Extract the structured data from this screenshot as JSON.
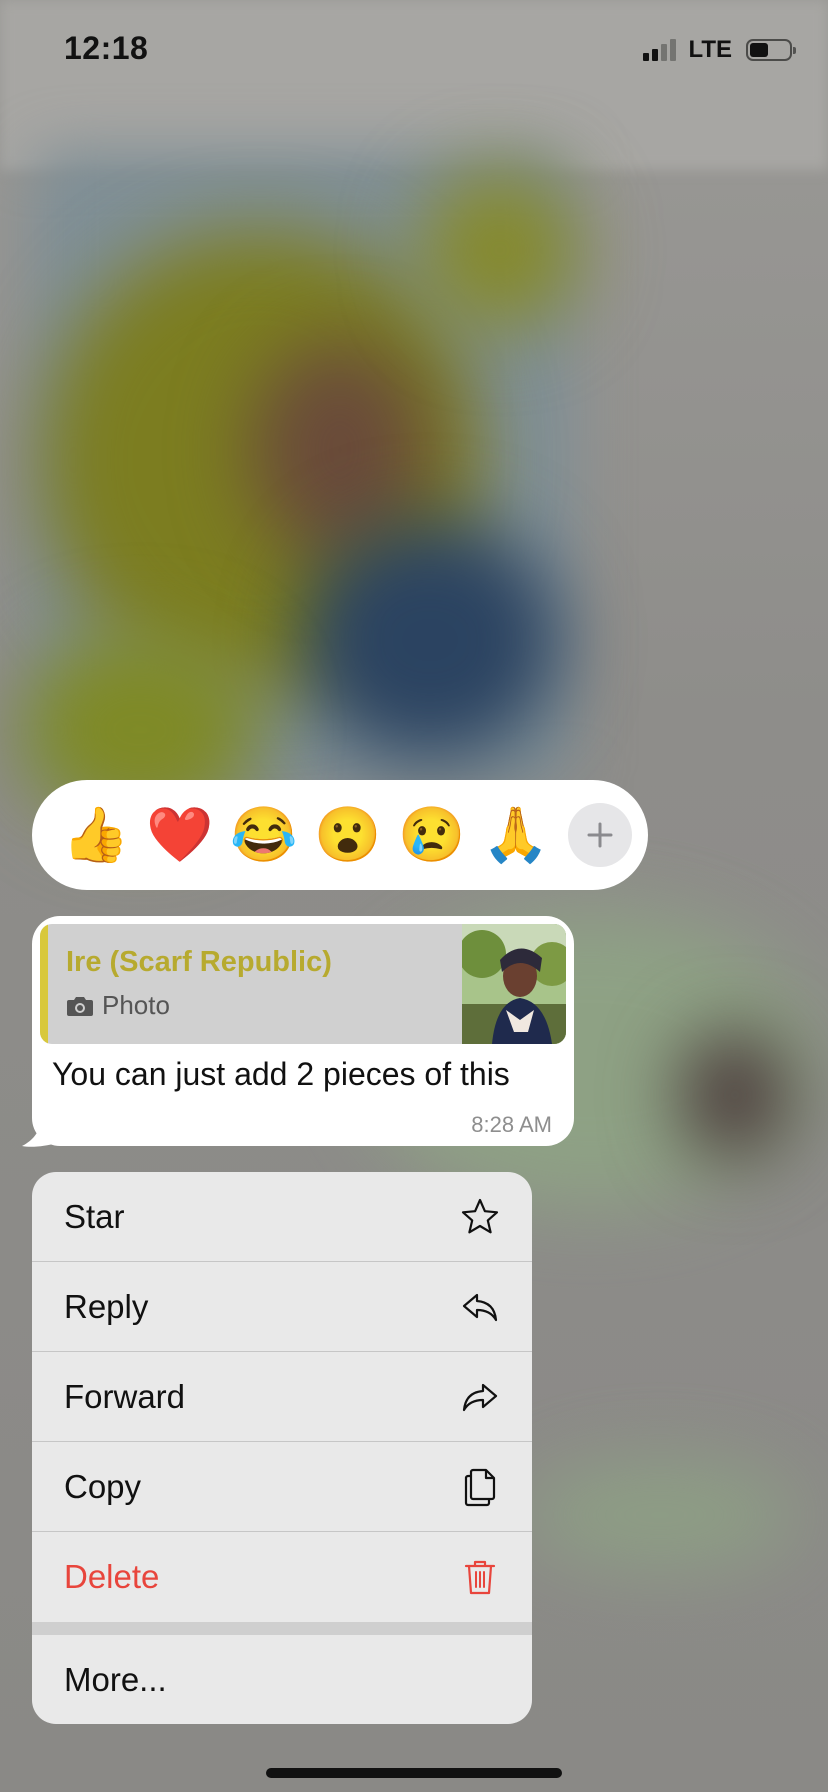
{
  "status_bar": {
    "time": "12:18",
    "network": "LTE"
  },
  "reactions": [
    {
      "name": "thumbs-up",
      "glyph": "👍"
    },
    {
      "name": "red-heart",
      "glyph": "❤️"
    },
    {
      "name": "tears-of-joy",
      "glyph": "😂"
    },
    {
      "name": "surprised",
      "glyph": "😮"
    },
    {
      "name": "crying",
      "glyph": "😢"
    },
    {
      "name": "folded-hands",
      "glyph": "🙏"
    }
  ],
  "reaction_more_icon": "plus-icon",
  "message": {
    "quote_sender": "Ire (Scarf Republic)",
    "quote_type": "Photo",
    "text": "You can just add 2 pieces of this",
    "time": "8:28 AM"
  },
  "menu": {
    "items": [
      {
        "label": "Star",
        "icon": "star-icon"
      },
      {
        "label": "Reply",
        "icon": "reply-icon"
      },
      {
        "label": "Forward",
        "icon": "forward-icon"
      },
      {
        "label": "Copy",
        "icon": "copy-icon"
      },
      {
        "label": "Delete",
        "icon": "trash-icon"
      }
    ],
    "more_label": "More..."
  },
  "colors": {
    "quote_accent": "#d8c83c",
    "quote_sender": "#b7aa2f",
    "destructive": "#e8453c"
  }
}
